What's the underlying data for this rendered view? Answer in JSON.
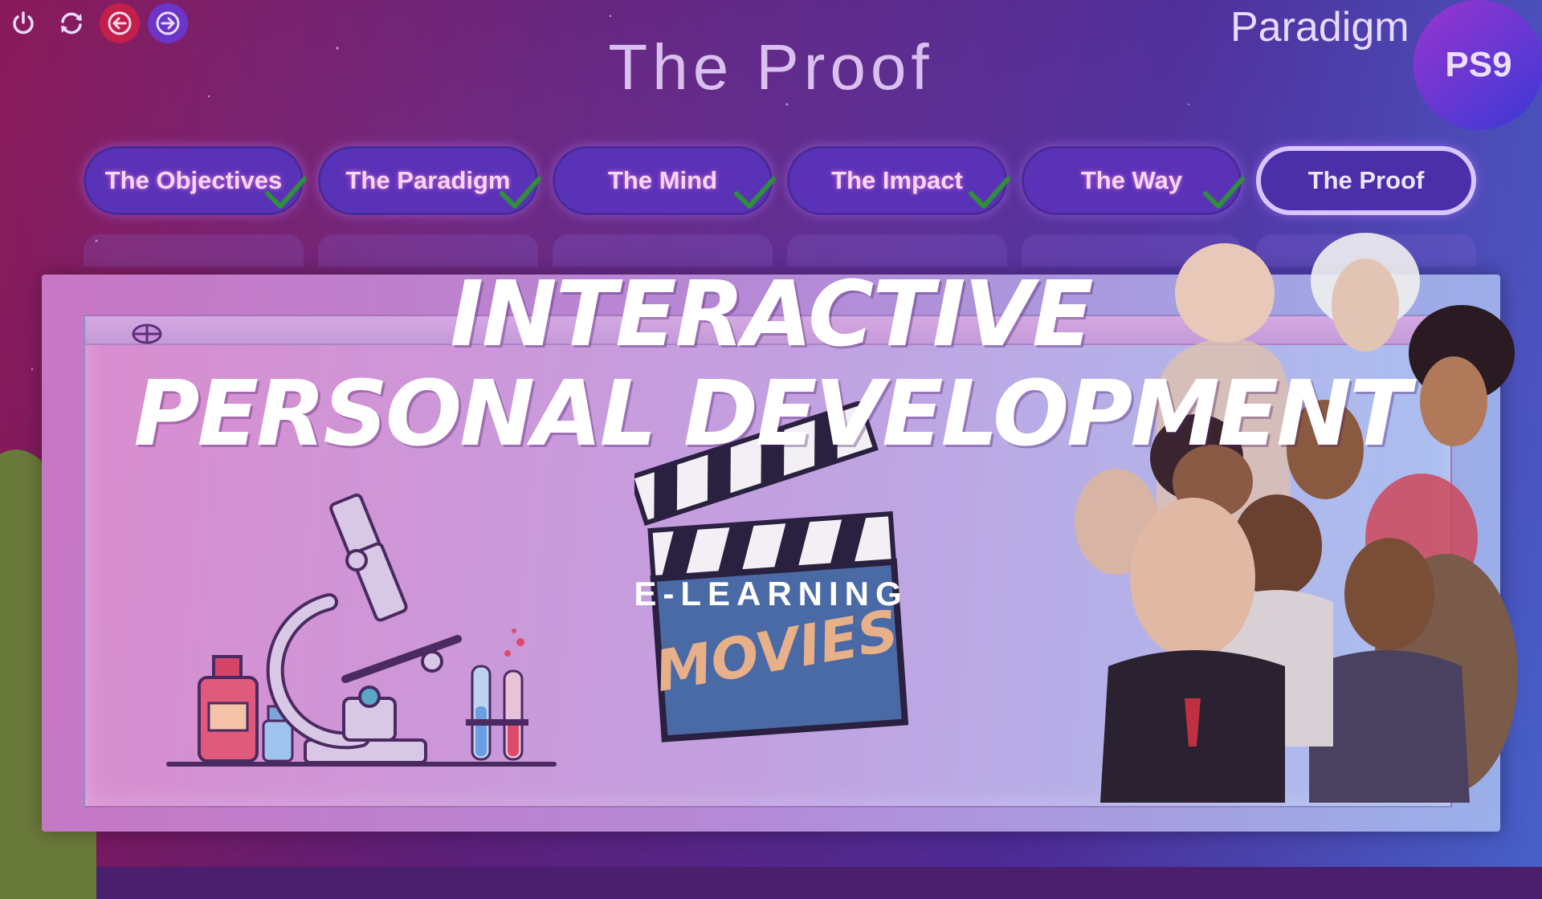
{
  "toolbar": {
    "buttons": [
      {
        "name": "power-icon"
      },
      {
        "name": "refresh-icon"
      },
      {
        "name": "back-arrow-icon"
      },
      {
        "name": "forward-arrow-icon"
      }
    ]
  },
  "brand": {
    "name": "Paradigm",
    "badge": "PS9"
  },
  "page": {
    "title": "The Proof"
  },
  "tabs": [
    {
      "label": "The Objectives",
      "completed": true
    },
    {
      "label": "The Paradigm",
      "completed": true
    },
    {
      "label": "The Mind",
      "completed": true
    },
    {
      "label": "The Impact",
      "completed": true
    },
    {
      "label": "The Way",
      "completed": true
    },
    {
      "label": "The Proof",
      "completed": false,
      "active": true
    }
  ],
  "overlay": {
    "headline_line1": "Interactive",
    "headline_line2": "Personal Development",
    "subtitle": "E-LEARNING"
  },
  "illustrations": {
    "clapperboard_text": "MOVIES"
  },
  "colors": {
    "accent_red": "#c41e4a",
    "accent_purple": "#6b35c8",
    "tab_fill": "#5a32b8",
    "check_green": "#2f8f3a",
    "badge_gradient_start": "#9a35cf",
    "badge_gradient_end": "#3a39d6"
  }
}
